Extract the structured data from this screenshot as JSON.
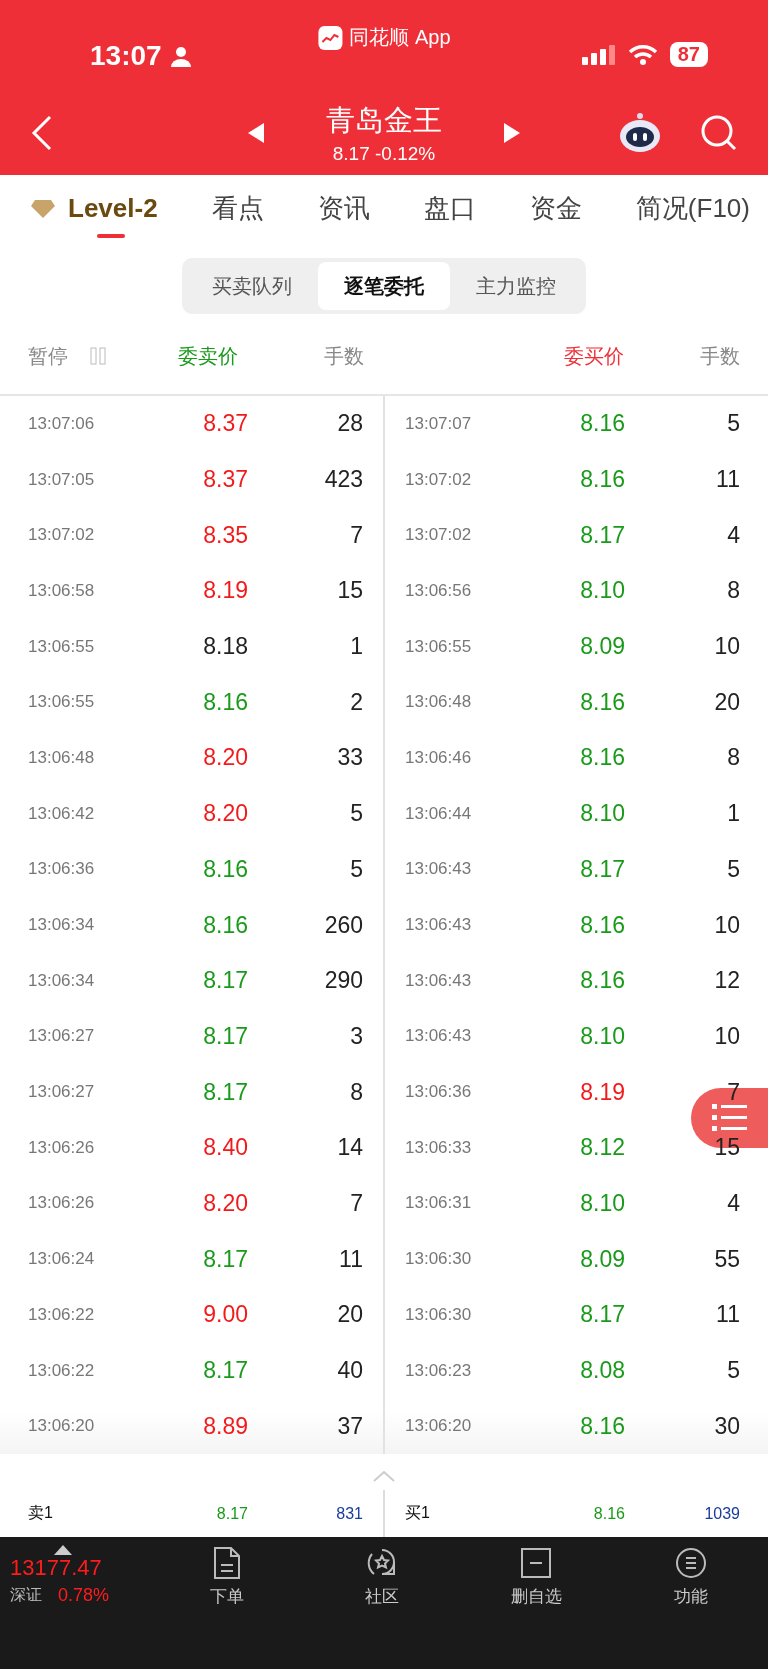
{
  "status_bar": {
    "time": "13:07",
    "app": "同花顺 App",
    "battery": "87"
  },
  "nav": {
    "title": "青岛金王",
    "quote": "8.17 -0.12%"
  },
  "tabs": [
    {
      "label": "Level-2",
      "selected": true
    },
    {
      "label": "看点",
      "selected": false
    },
    {
      "label": "资讯",
      "selected": false
    },
    {
      "label": "盘口",
      "selected": false
    },
    {
      "label": "资金",
      "selected": false
    },
    {
      "label": "简况(F10)",
      "selected": false
    }
  ],
  "segments": [
    {
      "label": "买卖队列",
      "selected": false
    },
    {
      "label": "逐笔委托",
      "selected": true
    },
    {
      "label": "主力监控",
      "selected": false
    }
  ],
  "columns": {
    "pause": "暂停",
    "sell_price": "委卖价",
    "sell_qty": "手数",
    "buy_price": "委买价",
    "buy_qty": "手数"
  },
  "sell_orders": [
    {
      "time": "13:07:06",
      "price": "8.37",
      "color": "#f21b1b",
      "qty": "28"
    },
    {
      "time": "13:07:05",
      "price": "8.37",
      "color": "#f21b1b",
      "qty": "423"
    },
    {
      "time": "13:07:02",
      "price": "8.35",
      "color": "#f21b1b",
      "qty": "7"
    },
    {
      "time": "13:06:58",
      "price": "8.19",
      "color": "#f21b1b",
      "qty": "15"
    },
    {
      "time": "13:06:55",
      "price": "8.18",
      "color": "#222222",
      "qty": "1"
    },
    {
      "time": "13:06:55",
      "price": "8.16",
      "color": "#1a9a1a",
      "qty": "2"
    },
    {
      "time": "13:06:48",
      "price": "8.20",
      "color": "#f21b1b",
      "qty": "33"
    },
    {
      "time": "13:06:42",
      "price": "8.20",
      "color": "#f21b1b",
      "qty": "5"
    },
    {
      "time": "13:06:36",
      "price": "8.16",
      "color": "#1a9a1a",
      "qty": "5"
    },
    {
      "time": "13:06:34",
      "price": "8.16",
      "color": "#1a9a1a",
      "qty": "260"
    },
    {
      "time": "13:06:34",
      "price": "8.17",
      "color": "#1a9a1a",
      "qty": "290"
    },
    {
      "time": "13:06:27",
      "price": "8.17",
      "color": "#1a9a1a",
      "qty": "3"
    },
    {
      "time": "13:06:27",
      "price": "8.17",
      "color": "#1a9a1a",
      "qty": "8"
    },
    {
      "time": "13:06:26",
      "price": "8.40",
      "color": "#f21b1b",
      "qty": "14"
    },
    {
      "time": "13:06:26",
      "price": "8.20",
      "color": "#f21b1b",
      "qty": "7"
    },
    {
      "time": "13:06:24",
      "price": "8.17",
      "color": "#1a9a1a",
      "qty": "11"
    },
    {
      "time": "13:06:22",
      "price": "9.00",
      "color": "#f21b1b",
      "qty": "20"
    },
    {
      "time": "13:06:22",
      "price": "8.17",
      "color": "#1a9a1a",
      "qty": "40"
    },
    {
      "time": "13:06:20",
      "price": "8.89",
      "color": "#f21b1b",
      "qty": "37"
    }
  ],
  "buy_orders": [
    {
      "time": "13:07:07",
      "price": "8.16",
      "color": "#1a9a1a",
      "qty": "5"
    },
    {
      "time": "13:07:02",
      "price": "8.16",
      "color": "#1a9a1a",
      "qty": "11"
    },
    {
      "time": "13:07:02",
      "price": "8.17",
      "color": "#1a9a1a",
      "qty": "4"
    },
    {
      "time": "13:06:56",
      "price": "8.10",
      "color": "#1a9a1a",
      "qty": "8"
    },
    {
      "time": "13:06:55",
      "price": "8.09",
      "color": "#1a9a1a",
      "qty": "10"
    },
    {
      "time": "13:06:48",
      "price": "8.16",
      "color": "#1a9a1a",
      "qty": "20"
    },
    {
      "time": "13:06:46",
      "price": "8.16",
      "color": "#1a9a1a",
      "qty": "8"
    },
    {
      "time": "13:06:44",
      "price": "8.10",
      "color": "#1a9a1a",
      "qty": "1"
    },
    {
      "time": "13:06:43",
      "price": "8.17",
      "color": "#1a9a1a",
      "qty": "5"
    },
    {
      "time": "13:06:43",
      "price": "8.16",
      "color": "#1a9a1a",
      "qty": "10"
    },
    {
      "time": "13:06:43",
      "price": "8.16",
      "color": "#1a9a1a",
      "qty": "12"
    },
    {
      "time": "13:06:43",
      "price": "8.10",
      "color": "#1a9a1a",
      "qty": "10"
    },
    {
      "time": "13:06:36",
      "price": "8.19",
      "color": "#f21b1b",
      "qty": "7"
    },
    {
      "time": "13:06:33",
      "price": "8.12",
      "color": "#1a9a1a",
      "qty": "15"
    },
    {
      "time": "13:06:31",
      "price": "8.10",
      "color": "#1a9a1a",
      "qty": "4"
    },
    {
      "time": "13:06:30",
      "price": "8.09",
      "color": "#1a9a1a",
      "qty": "55"
    },
    {
      "time": "13:06:30",
      "price": "8.17",
      "color": "#1a9a1a",
      "qty": "11"
    },
    {
      "time": "13:06:23",
      "price": "8.08",
      "color": "#1a9a1a",
      "qty": "5"
    },
    {
      "time": "13:06:20",
      "price": "8.16",
      "color": "#1a9a1a",
      "qty": "30"
    }
  ],
  "best": [
    {
      "label": "卖1",
      "price": "8.17",
      "qty": "831"
    },
    {
      "label": "买1",
      "price": "8.16",
      "qty": "1039"
    }
  ],
  "index": {
    "value": "13177.47",
    "name": "深证",
    "change": "0.78%"
  },
  "bottom_nav": [
    {
      "kind": "order",
      "label": "下单"
    },
    {
      "kind": "community",
      "label": "社区"
    },
    {
      "kind": "remove",
      "label": "删自选"
    },
    {
      "kind": "menu",
      "label": "功能"
    }
  ]
}
